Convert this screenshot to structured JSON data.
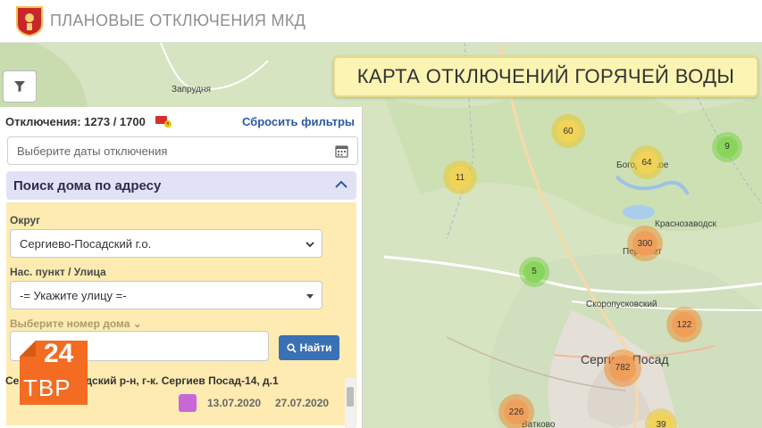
{
  "header": {
    "title": "ПЛАНОВЫЕ ОТКЛЮЧЕНИЯ МКД",
    "logo": "moscow-oblast-coat-of-arms"
  },
  "map": {
    "title": "КАРТА ОТКЛЮЧЕНИЙ ГОРЯЧЕЙ ВОДЫ",
    "labels": {
      "zaprudnya": "Запрудня",
      "bogorodskoe": "Богородское",
      "krasnozavodsk": "Краснозаводск",
      "peresvet": "Пересвет",
      "skoropusk": "Скоропусковский",
      "sergiev": "Сергиев Посад",
      "vyatkovo": "Ватково"
    },
    "clusters": {
      "c60": "60",
      "c64": "64",
      "c9": "9",
      "c11": "11",
      "c300": "300",
      "c5": "5",
      "c122": "122",
      "c782": "782",
      "c226": "226",
      "c39": "39"
    },
    "colors": {
      "yellow": "#f1d357",
      "green": "#86d65a",
      "orange": "#f09e5a"
    }
  },
  "panel": {
    "stats": "Отключения: 1273 / 1700",
    "reset": "Сбросить фильтры",
    "date_placeholder": "Выберите даты отключения",
    "search_header": "Поиск дома по адресу",
    "district_label": "Округ",
    "district_value": "Сергиево-Посадский г.о.",
    "street_label": "Нас. пункт / Улица",
    "street_value": "-= Укажите улицу =-",
    "house_label": "Выберите номер дома",
    "house_value": "",
    "find_button": "Найти",
    "result_text": "Сергиево-Посадский р-н, г-к. Сергиев Посад-14, д.1",
    "result_date_from": "13.07.2020",
    "result_date_to": "27.07.2020"
  },
  "watermark": {
    "number": "24",
    "name": "ТВР"
  }
}
